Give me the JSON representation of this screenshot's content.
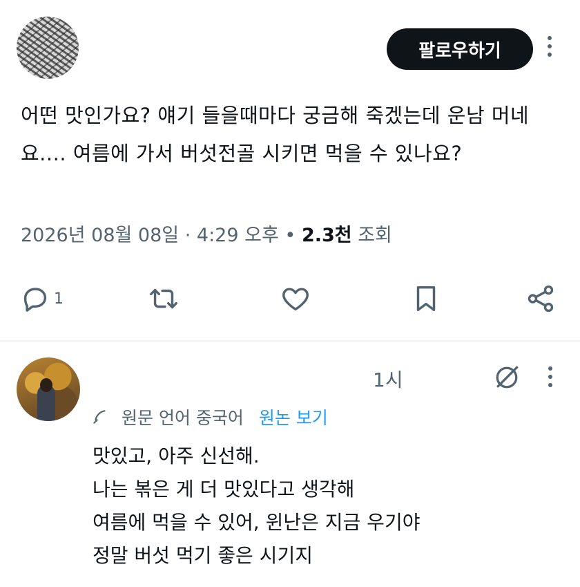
{
  "tweet": {
    "follow_label": "팔로우하기",
    "text": "어떤 맛인가요? 얘기 들을때마다 궁금해 죽겠는데 운남 머네요.... 여름에 가서 버섯전골 시키면 먹을 수 있나요?",
    "date": "2026년 08월 08일",
    "separator": "·",
    "time": "4:29 오후",
    "bullet": "•",
    "views_count": "2.3천",
    "views_label": "조회",
    "reply_count": "1"
  },
  "reply": {
    "time": "1시",
    "translation_note": "원문 언어 중국어",
    "show_original": "원논 보기",
    "lines": [
      "맛있고, 아주 신선해.",
      "나는 볶은 게 더 맛있다고 생각해",
      "여름에 먹을 수 있어, 윈난은 지금 우기야",
      "정말 버섯 먹기 좋은 시기지"
    ]
  },
  "icons": {
    "reply": "reply-icon",
    "retweet": "retweet-icon",
    "like": "heart-icon",
    "bookmark": "bookmark-icon",
    "share": "share-icon",
    "more": "more-icon",
    "grok": "grok-icon",
    "translate": "translate-icon"
  },
  "colors": {
    "text": "#0f1419",
    "muted": "#536471",
    "link": "#1d9bf0",
    "button_bg": "#0f1419"
  }
}
